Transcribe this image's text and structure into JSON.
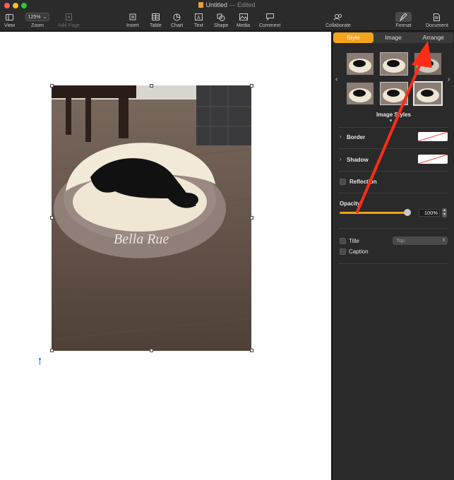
{
  "window": {
    "title": "Untitled",
    "separator": "—",
    "status": "Edited"
  },
  "toolbar": {
    "view": "View",
    "zoom_value": "125%",
    "zoom": "Zoom",
    "add_page": "Add Page",
    "insert": "Insert",
    "table": "Table",
    "chart": "Chart",
    "text": "Text",
    "shape": "Shape",
    "media": "Media",
    "comment": "Comment",
    "collaborate": "Collaborate",
    "format": "Format",
    "document": "Document"
  },
  "canvas": {
    "photo_caption_text": "Bella Rue"
  },
  "panel": {
    "tabs": [
      "Style",
      "Image",
      "Arrange"
    ],
    "image_styles_label": "Image Styles",
    "border_label": "Border",
    "shadow_label": "Shadow",
    "reflection_label": "Reflection",
    "opacity_label": "Opacity",
    "opacity_value": "100%",
    "opacity_fraction": 1.0,
    "title_label": "Title",
    "title_position": "Top",
    "caption_label": "Caption"
  },
  "colors": {
    "accent": "#f3a41c",
    "arrow": "#ff2d16",
    "close": "#ff5f57",
    "minimize": "#febc2e",
    "zoom": "#28c840"
  }
}
